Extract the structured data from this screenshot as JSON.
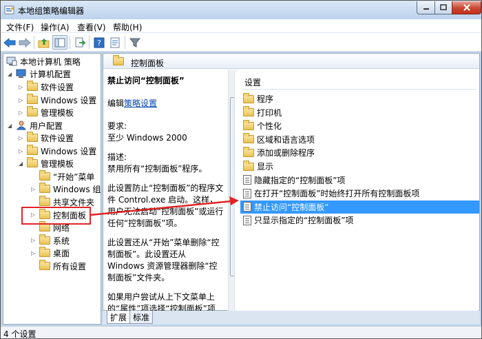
{
  "window": {
    "title": "本地组策略编辑器"
  },
  "menu": [
    "文件(F)",
    "操作(A)",
    "查看(V)",
    "帮助(H)"
  ],
  "tree": {
    "root": "本地计算机 策略",
    "computer_config": "计算机配置",
    "cc_software": "软件设置",
    "cc_windows": "Windows 设置",
    "cc_admin": "管理模板",
    "user_config": "用户配置",
    "uc_software": "软件设置",
    "uc_windows": "Windows 设置",
    "uc_admin": "管理模板",
    "start_menu": "“开始”菜单",
    "windows_components": "Windows 组件",
    "shared_folders": "共享文件夹",
    "control_panel": "控制面板",
    "network": "网络",
    "system": "系统",
    "desktop": "桌面",
    "all_settings": "所有设置"
  },
  "content": {
    "header": "控制面板",
    "policy_title": "禁止访问“控制面板”",
    "edit_prefix": "编辑",
    "edit_link": "策略设置",
    "req_label": "要求:",
    "req_value": "至少 Windows 2000",
    "desc_label": "描述:",
    "desc_1": "禁用所有“控制面板”程序。",
    "desc_2": "此设置防止“控制面板”的程序文件 Control.exe 启动。这样，用户无法启动“控制面板”或运行任何“控制面板”项。",
    "desc_3": "此设置还从“开始”菜单删除“控制面板”。此设置还从 Windows 资源管理器删除“控制面板”文件夹。",
    "desc_4": "如果用户尝试从上下文菜单上的“属性”项选择“控制面板”项"
  },
  "list": {
    "header": "设置",
    "items": [
      {
        "label": "程序",
        "icon": "folder-icon"
      },
      {
        "label": "打印机",
        "icon": "folder-icon"
      },
      {
        "label": "个性化",
        "icon": "folder-icon"
      },
      {
        "label": "区域和语言选项",
        "icon": "folder-icon"
      },
      {
        "label": "添加或删除程序",
        "icon": "folder-icon"
      },
      {
        "label": "显示",
        "icon": "folder-icon"
      },
      {
        "label": "隐藏指定的“控制面板”项",
        "icon": "policy-icon"
      },
      {
        "label": "在打开“控制面板”时始终打开所有控制面板项",
        "icon": "policy-icon"
      },
      {
        "label": "禁止访问“控制面板”",
        "icon": "policy-icon",
        "selected": true
      },
      {
        "label": "只显示指定的“控制面板”项",
        "icon": "policy-icon"
      }
    ]
  },
  "tabs": [
    "扩展",
    "标准"
  ],
  "status": "4 个设置",
  "colors": {
    "selection": "#3399ff",
    "highlight": "#e02525",
    "link": "#0645ad"
  }
}
